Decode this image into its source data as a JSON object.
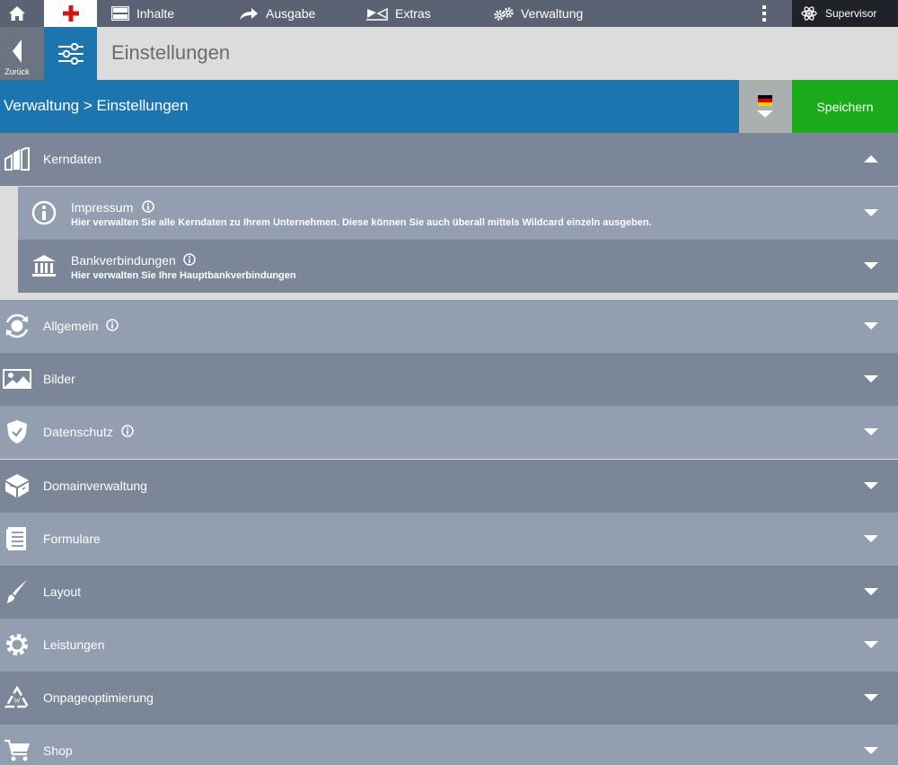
{
  "topnav": {
    "items": [
      {
        "label": "Inhalte",
        "icon": "content-icon"
      },
      {
        "label": "Ausgabe",
        "icon": "output-arrow-icon"
      },
      {
        "label": "Extras",
        "icon": "extras-icon"
      },
      {
        "label": "Verwaltung",
        "icon": "gears-icon"
      }
    ],
    "user_label": "Supervisor"
  },
  "header": {
    "back_label": "Zurück",
    "page_title": "Einstellungen"
  },
  "bluebar": {
    "breadcrumb": "Verwaltung > Einstellungen",
    "save_label": "Speichern",
    "language": "de"
  },
  "sections": [
    {
      "label": "Kerndaten",
      "icon": "buildings-icon",
      "expanded": true,
      "info": false
    },
    {
      "label": "Allgemein",
      "icon": "globe-refresh-icon",
      "info": true
    },
    {
      "label": "Bilder",
      "icon": "image-icon",
      "info": false
    },
    {
      "label": "Datenschutz",
      "icon": "shield-check-icon",
      "info": true
    },
    {
      "label": "Domainverwaltung",
      "icon": "domain-cube-icon",
      "info": false
    },
    {
      "label": "Formulare",
      "icon": "form-list-icon",
      "info": false
    },
    {
      "label": "Layout",
      "icon": "brush-icon",
      "info": false
    },
    {
      "label": "Leistungen",
      "icon": "gear-icon",
      "info": false
    },
    {
      "label": "Onpageoptimierung",
      "icon": "recycle-w-icon",
      "info": false
    },
    {
      "label": "Shop",
      "icon": "cart-icon",
      "info": false
    }
  ],
  "kerndaten_items": [
    {
      "title": "Impressum",
      "desc": "Hier verwalten Sie alle Kerndaten zu Ihrem Unternehmen. Diese können Sie auch überall mittels Wildcard einzeln ausgeben.",
      "icon": "info-circle-icon"
    },
    {
      "title": "Bankverbindungen",
      "desc": "Hier verwalten Sie Ihre Hauptbankverbindungen",
      "icon": "bank-icon"
    }
  ],
  "colors": {
    "topbar": "#5b6273",
    "blue": "#1c75ae",
    "save_green": "#1aaa1a",
    "row_dark": "#7b8699",
    "row_light": "#939eb0",
    "plus_red": "#cc1a1a"
  }
}
